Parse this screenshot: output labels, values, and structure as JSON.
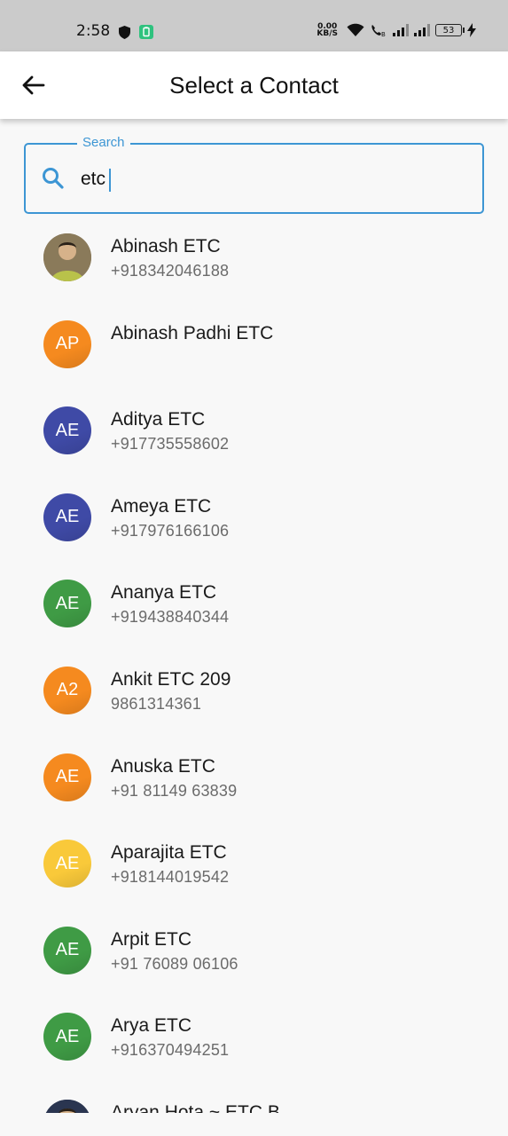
{
  "status_bar": {
    "time": "2:58",
    "net_speed_value": "0.00",
    "net_speed_unit": "KB/S",
    "battery": "53"
  },
  "app_bar": {
    "title": "Select a Contact"
  },
  "search": {
    "label": "Search",
    "value": "etc"
  },
  "colors": {
    "accent": "#3d96d4",
    "orange": "#f58a1f",
    "indigo": "#3f4aa6",
    "green": "#3f9b45",
    "yellow": "#f9c93a"
  },
  "contacts": [
    {
      "name": "Abinash ETC",
      "phone": "+918342046188",
      "initials": "",
      "avatar_type": "photo",
      "color": "#8a7a5a"
    },
    {
      "name": "Abinash Padhi ETC",
      "phone": "",
      "initials": "AP",
      "avatar_type": "initials",
      "color": "#f58a1f"
    },
    {
      "name": "Aditya ETC",
      "phone": "+917735558602",
      "initials": "AE",
      "avatar_type": "initials",
      "color": "#3f4aa6"
    },
    {
      "name": "Ameya ETC",
      "phone": "+917976166106",
      "initials": "AE",
      "avatar_type": "initials",
      "color": "#3f4aa6"
    },
    {
      "name": "Ananya ETC",
      "phone": "+919438840344",
      "initials": "AE",
      "avatar_type": "initials",
      "color": "#3f9b45"
    },
    {
      "name": "Ankit ETC 209",
      "phone": "9861314361",
      "initials": "A2",
      "avatar_type": "initials",
      "color": "#f58a1f"
    },
    {
      "name": "Anuska ETC",
      "phone": "+91 81149 63839",
      "initials": "AE",
      "avatar_type": "initials",
      "color": "#f58a1f"
    },
    {
      "name": "Aparajita ETC",
      "phone": "+918144019542",
      "initials": "AE",
      "avatar_type": "initials",
      "color": "#f9c93a"
    },
    {
      "name": "Arpit ETC",
      "phone": "+91 76089 06106",
      "initials": "AE",
      "avatar_type": "initials",
      "color": "#3f9b45"
    },
    {
      "name": "Arya ETC",
      "phone": "+916370494251",
      "initials": "AE",
      "avatar_type": "initials",
      "color": "#3f9b45"
    },
    {
      "name": "Aryan Hota ~ ETC B",
      "phone": "",
      "initials": "",
      "avatar_type": "photo",
      "color": "#2a3550"
    }
  ]
}
